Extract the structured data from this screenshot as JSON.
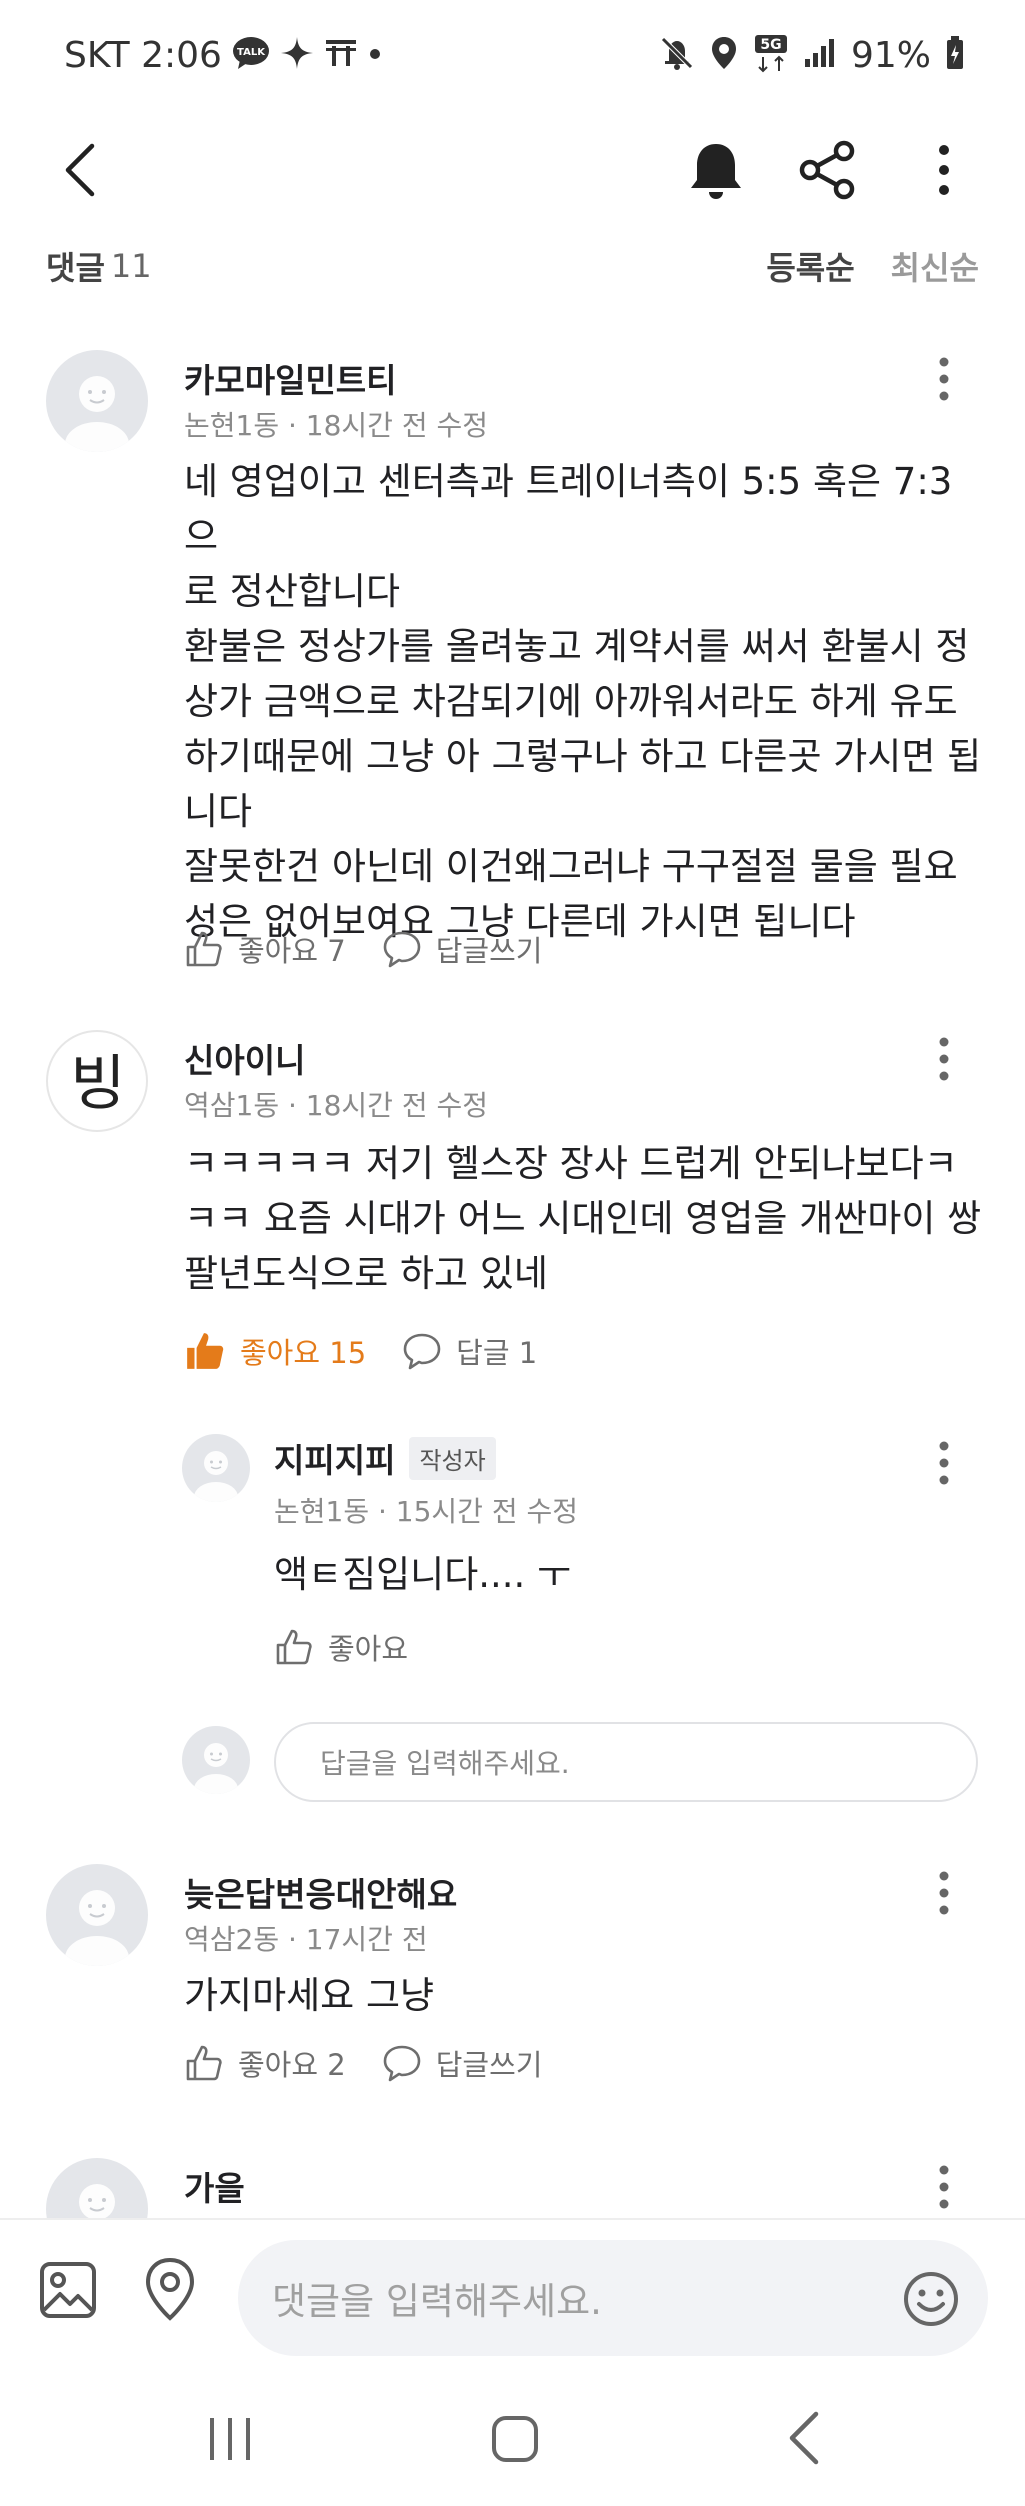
{
  "status_bar": {
    "carrier_time": "SKT 2:06",
    "battery": "91%"
  },
  "header": {
    "comment_label": "댓글",
    "comment_count": "11",
    "sort_options": [
      "등록순",
      "최신순"
    ]
  },
  "comments": [
    {
      "name": "카모마일민트티",
      "meta": "논현1동 · 18시간 전 수정",
      "body": "네 영업이고 센터측과 트레이너측이 5:5 혹은 7:3으\n로 정산합니다\n환불은 정상가를 올려놓고 계약서를 써서 환불시 정\n상가 금액으로 차감되기에 아까워서라도 하게 유도\n하기때문에 그냥 아 그렇구나 하고 다른곳 가시면 됩\n니다\n잘못한건 아닌데 이건왜그러냐 구구절절 물을 필요\n성은 없어보여요 그냥 다른데 가시면 됩니다",
      "like_label": "좋아요 7",
      "reply_label": "답글쓰기"
    },
    {
      "name": "신아이니",
      "avatar_text": "빙",
      "meta": "역삼1동 · 18시간 전 수정",
      "body": "ㅋㅋㅋㅋㅋ 저기 헬스장 장사 드럽게 안되나보다ㅋ\nㅋㅋ 요즘 시대가 어느 시대인데 영업을 개싼마이 쌍\n팔년도식으로 하고 있네",
      "like_label": "좋아요 15",
      "reply_label": "답글 1"
    },
    {
      "name": "늦은답변응대안해요",
      "meta": "역삼2동 · 17시간 전",
      "body": "가지마세요 그냥",
      "like_label": "좋아요 2",
      "reply_label": "답글쓰기"
    },
    {
      "name": "가을"
    }
  ],
  "reply": {
    "name": "지피지피",
    "badge": "작성자",
    "meta": "논현1동 · 15시간 전 수정",
    "body": "액ㅌ짐입니다.... ㅜ",
    "like_label": "좋아요"
  },
  "reply_input": {
    "placeholder": "답글을 입력해주세요."
  },
  "comment_input": {
    "placeholder": "댓글을 입력해주세요."
  },
  "colors": {
    "accent_orange": "#e47b1a",
    "text": "#212124",
    "meta": "#8a8a8a"
  }
}
